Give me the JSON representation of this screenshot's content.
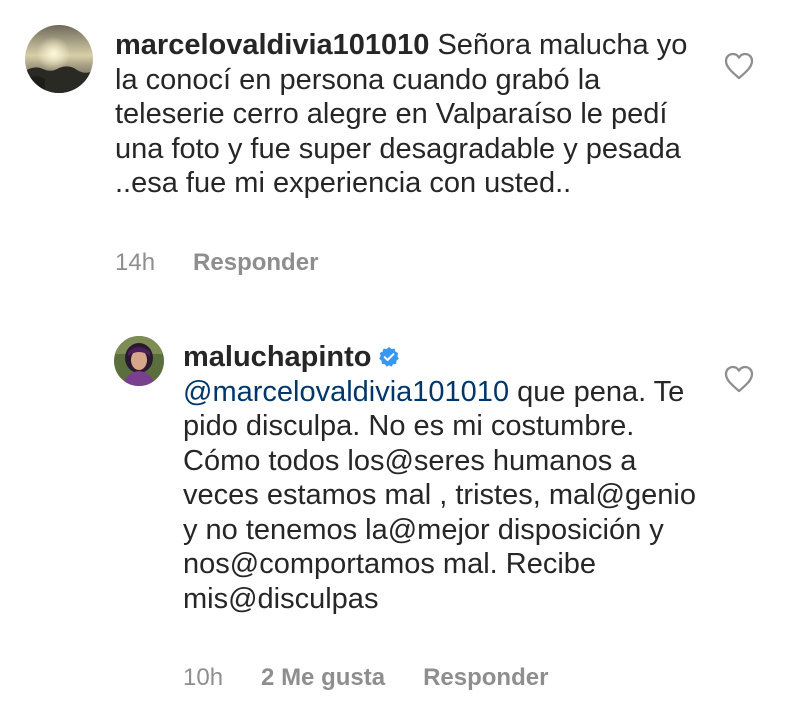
{
  "comments": [
    {
      "username": "marcelovaldivia101010",
      "text": " Señora malucha yo la conocí en persona cuando grabó la teleserie cerro alegre en Valparaíso le pedí una foto y fue super desagradable y pesada ..esa fue mi experiencia con usted..",
      "time": "14h",
      "reply_label": "Responder",
      "verified": false
    },
    {
      "username": "maluchapinto",
      "mention": "@marcelovaldivia101010",
      "text": " que pena. Te pido disculpa. No es mi costumbre. Cómo todos los@seres humanos a veces estamos mal , tristes, mal@genio y no tenemos la@mejor disposición y nos@comportamos mal. Recibe mis@disculpas",
      "time": "10h",
      "likes_label": "2 Me gusta",
      "reply_label": "Responder",
      "verified": true
    }
  ],
  "colors": {
    "text": "#262626",
    "secondary": "#8e8e8e",
    "mention": "#00376b",
    "verified": "#3897f0"
  },
  "icons": {
    "like": "heart-outline-icon",
    "verified": "verified-badge-icon"
  }
}
